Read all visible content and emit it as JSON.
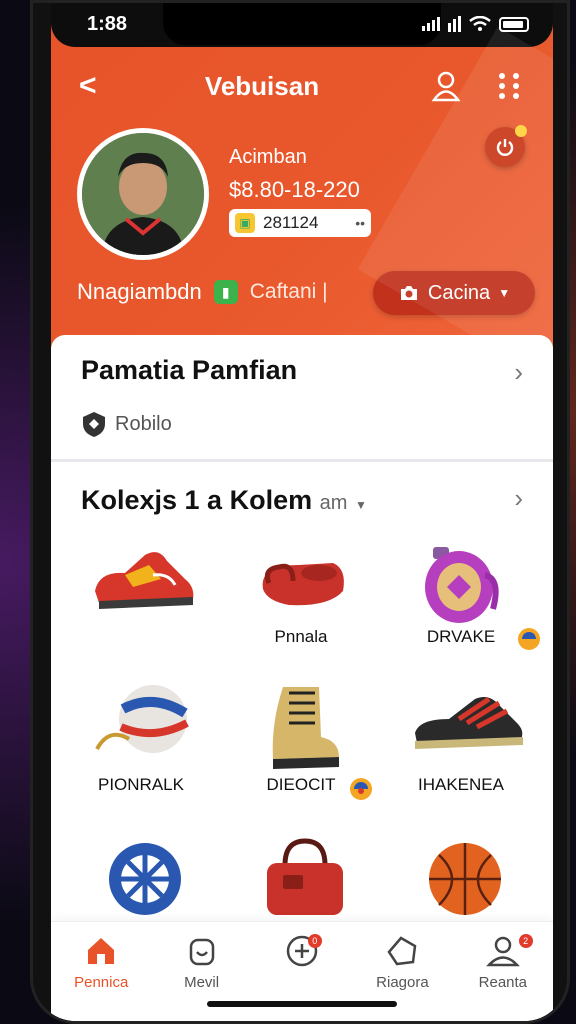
{
  "status": {
    "time": "1:88"
  },
  "header": {
    "title": "Vebuisan",
    "back_label": "<"
  },
  "profile": {
    "name": "Acimban",
    "money": "$8.80-18-220",
    "code": "281124",
    "code_more": "••",
    "handle": "Nnagiambdn",
    "tag": "Caftani |",
    "camera_label": "Cacina"
  },
  "section1": {
    "title": "Pamatia Pamfian",
    "sub": "Robilo"
  },
  "section2": {
    "title": "Kolexjs 1 a Kolem",
    "more": "am"
  },
  "items": [
    {
      "label": "",
      "icon": "shoe-icon"
    },
    {
      "label": "Pnnala",
      "icon": "bag-icon"
    },
    {
      "label": "DRVAKE",
      "icon": "backpack-icon"
    },
    {
      "label": "PIONRALK",
      "icon": "ball-icon"
    },
    {
      "label": "DIEOCIT",
      "icon": "boot-icon"
    },
    {
      "label": "IHAKENEA",
      "icon": "sneaker-icon"
    },
    {
      "label": "",
      "icon": "wheel-icon"
    },
    {
      "label": "",
      "icon": "bag-icon"
    },
    {
      "label": "",
      "icon": "basketball-icon"
    }
  ],
  "tabs": [
    {
      "label": "Pennica",
      "icon": "home-icon",
      "active": true
    },
    {
      "label": "Mevil",
      "icon": "bag-icon"
    },
    {
      "label": "",
      "icon": "plus-icon",
      "badge": "0"
    },
    {
      "label": "Riagora",
      "icon": "tag-icon"
    },
    {
      "label": "Reanta",
      "icon": "user-icon",
      "badge": "2"
    }
  ],
  "colors": {
    "accent": "#e8532a",
    "dark_accent": "#c1311c",
    "badge": "#e23b2a"
  }
}
